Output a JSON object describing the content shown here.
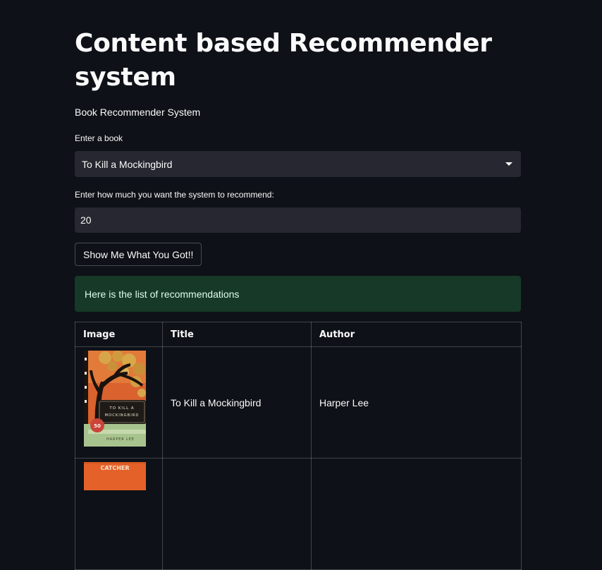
{
  "page": {
    "title": "Content based Recommender system",
    "subtitle": "Book Recommender System"
  },
  "form": {
    "book_label": "Enter a book",
    "book_selected": "To Kill a Mockingbird",
    "count_label": "Enter how much you want the system to recommend:",
    "count_value": "20",
    "submit_label": "Show Me What You Got!!"
  },
  "alert": {
    "message": "Here is the list of recommendations",
    "color": "#173928"
  },
  "table": {
    "headers": [
      "Image",
      "Title",
      "Author"
    ],
    "rows": [
      {
        "title": "To Kill a Mockingbird",
        "author": "Harper Lee",
        "cover": {
          "lines": [
            "TO KILL A",
            "MOCKINGBIRD"
          ],
          "badge": "50",
          "author": "HARPER LEE"
        }
      },
      {
        "title": "",
        "author": "",
        "cover": {
          "lines": [
            "CATCHER"
          ]
        }
      }
    ]
  },
  "colors": {
    "background": "#0e1117",
    "input_bg": "#262730",
    "text": "#fafafa"
  }
}
